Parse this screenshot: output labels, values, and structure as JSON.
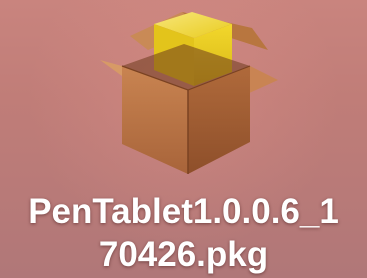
{
  "desktop": {
    "file": {
      "name_line1": "PenTablet1.0.0.6_1",
      "name_line2": "70426.pkg",
      "icon": "package-installer-icon"
    }
  },
  "colors": {
    "background": "#c07d78",
    "box_brown": "#b57544",
    "box_yellow": "#f1d21a",
    "label_text": "#ffffff"
  }
}
